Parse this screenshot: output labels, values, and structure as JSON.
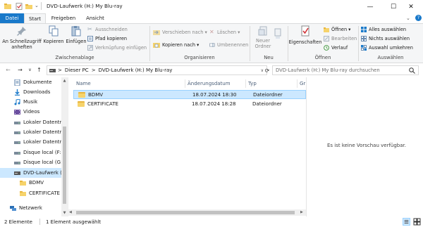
{
  "title": {
    "window_title": "DVD-Laufwerk (H:) My Blu-ray",
    "minimize": "—",
    "maximize": "☐",
    "close": "✕"
  },
  "tabs": [
    {
      "label": "Datei",
      "active_file": true
    },
    {
      "label": "Start",
      "selected": true
    },
    {
      "label": "Freigeben"
    },
    {
      "label": "Ansicht"
    }
  ],
  "ribbon": {
    "zwischenablage": {
      "group_label": "Zwischenablage",
      "pin_label_1": "An Schnellzugriff",
      "pin_label_2": "anheften",
      "copy_label": "Kopieren",
      "paste_label": "Einfügen",
      "cut_label": "Ausschneiden",
      "copy_path_label": "Pfad kopieren",
      "paste_shortcut_label": "Verknüpfung einfügen"
    },
    "organisieren": {
      "group_label": "Organisieren",
      "move_label": "Verschieben nach",
      "copy_to_label": "Kopieren nach",
      "delete_label": "Löschen",
      "rename_label": "Umbenennen"
    },
    "neu": {
      "group_label": "Neu",
      "new_folder_label_1": "Neuer",
      "new_folder_label_2": "Ordner"
    },
    "oeffnen": {
      "group_label": "Öffnen",
      "properties_label": "Eigenschaften",
      "open_label": "Öffnen",
      "edit_label": "Bearbeiten",
      "history_label": "Verlauf"
    },
    "auswaehlen": {
      "group_label": "Auswählen",
      "select_all_label": "Alles auswählen",
      "select_none_label": "Nichts auswählen",
      "invert_label": "Auswahl umkehren"
    }
  },
  "address": {
    "back": "←",
    "forward": "→",
    "recent": "∨",
    "up": "↑",
    "crumb_1": "Dieser PC",
    "crumb_2": "DVD-Laufwerk (H:) My Blu-ray",
    "sep": ">",
    "dropdown": "∨",
    "refresh": "⟳",
    "search_placeholder": "DVD-Laufwerk (H:) My Blu-ray durchsuchen"
  },
  "nav": [
    {
      "label": "Dokumente",
      "icon": "documents-icon"
    },
    {
      "label": "Downloads",
      "icon": "downloads-icon"
    },
    {
      "label": "Musik",
      "icon": "music-icon"
    },
    {
      "label": "Videos",
      "icon": "videos-icon"
    },
    {
      "label": "Lokaler Datenträ",
      "icon": "drive-icon"
    },
    {
      "label": "Lokaler Datenträ",
      "icon": "drive-icon"
    },
    {
      "label": "Lokaler Datenträ",
      "icon": "drive-icon"
    },
    {
      "label": "Disque local (F:)",
      "icon": "drive-icon"
    },
    {
      "label": "Disque local (G:)",
      "icon": "drive-icon"
    },
    {
      "label": "DVD-Laufwerk (H",
      "icon": "dvd-drive-icon",
      "selected": true
    },
    {
      "label": "BDMV",
      "icon": "folder-icon"
    },
    {
      "label": "CERTIFICATE",
      "icon": "folder-icon"
    },
    {
      "label": "Netzwerk",
      "icon": "network-icon"
    }
  ],
  "columns": {
    "name": "Name",
    "date": "Änderungsdatum",
    "type": "Typ",
    "size": "Gr"
  },
  "files": [
    {
      "name": "BDMV",
      "date": "18.07.2024 18:30",
      "type": "Dateiordner",
      "selected": true
    },
    {
      "name": "CERTIFICATE",
      "date": "18.07.2024 18:28",
      "type": "Dateiordner"
    }
  ],
  "preview_text": "Es ist keine Vorschau verfügbar.",
  "status": {
    "count": "2 Elemente",
    "selection": "1 Element ausgewählt"
  },
  "colors": {
    "accent": "#1979ca",
    "selection": "#cce8ff",
    "folder": "#f6d36b"
  }
}
